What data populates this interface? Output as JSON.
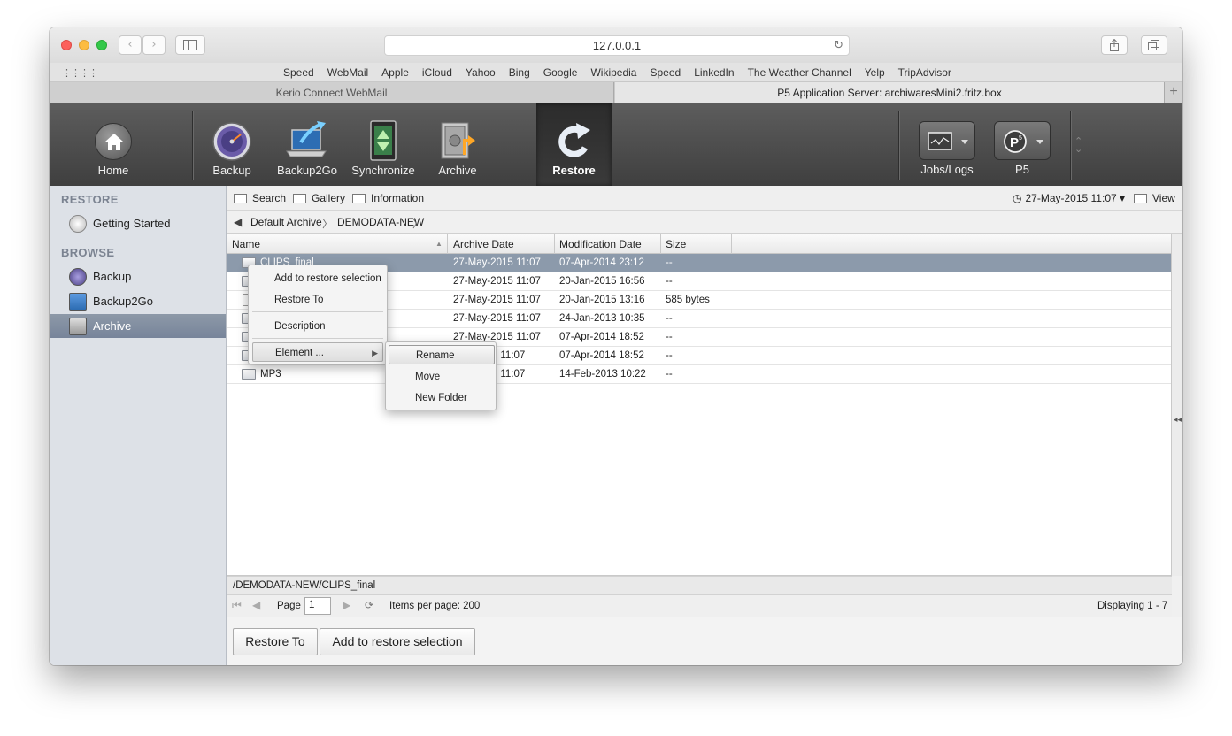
{
  "browser": {
    "url": "127.0.0.1",
    "bookmarks": [
      "Speed",
      "WebMail",
      "Apple",
      "iCloud",
      "Yahoo",
      "Bing",
      "Google",
      "Wikipedia",
      "Speed",
      "LinkedIn",
      "The Weather Channel",
      "Yelp",
      "TripAdvisor"
    ],
    "tabs": [
      {
        "label": "Kerio Connect WebMail",
        "active": false
      },
      {
        "label": "P5 Application Server: archiwaresMini2.fritz.box",
        "active": true
      }
    ],
    "new_tab_symbol": "+"
  },
  "toolbar": {
    "home": "Home",
    "backup": "Backup",
    "backup2go": "Backup2Go",
    "synchronize": "Synchronize",
    "archive": "Archive",
    "restore": "Restore",
    "jobs_logs": "Jobs/Logs",
    "p5": "P5",
    "active": "Restore"
  },
  "sidebar": {
    "restore_heading": "RESTORE",
    "getting_started": "Getting Started",
    "browse_heading": "BROWSE",
    "items": [
      "Backup",
      "Backup2Go",
      "Archive"
    ],
    "selected": "Archive"
  },
  "main": {
    "search": "Search",
    "gallery": "Gallery",
    "information": "Information",
    "date_selector": "27-May-2015 11:07",
    "view": "View",
    "breadcrumb": [
      "Default Archive",
      "DEMODATA-NEW"
    ],
    "columns": {
      "name": "Name",
      "archive_date": "Archive Date",
      "modification_date": "Modification Date",
      "size": "Size"
    },
    "rows": [
      {
        "name": "CLIPS_final",
        "archive_date": "27-May-2015 11:07",
        "modification_date": "07-Apr-2014 23:12",
        "size": "--",
        "kind": "folder",
        "selected": true
      },
      {
        "name": "",
        "archive_date": "27-May-2015 11:07",
        "modification_date": "20-Jan-2015 16:56",
        "size": "--",
        "kind": "folder"
      },
      {
        "name": "",
        "archive_date": "27-May-2015 11:07",
        "modification_date": "20-Jan-2015 13:16",
        "size": "585 bytes",
        "kind": "file"
      },
      {
        "name": "",
        "archive_date": "27-May-2015 11:07",
        "modification_date": "24-Jan-2013 10:35",
        "size": "--",
        "kind": "folder"
      },
      {
        "name": "",
        "archive_date": "27-May-2015 11:07",
        "modification_date": "07-Apr-2014 18:52",
        "size": "--",
        "kind": "folder"
      },
      {
        "name": "",
        "archive_date": "015 11:07",
        "modification_date": "07-Apr-2014 18:52",
        "size": "--",
        "kind": "folder"
      },
      {
        "name": "MP3",
        "archive_date": "015 11:07",
        "modification_date": "14-Feb-2013 10:22",
        "size": "--",
        "kind": "folder"
      }
    ],
    "path": "/DEMODATA-NEW/CLIPS_final",
    "page_label": "Page",
    "page_value": "1",
    "items_per_page": "Items per page: 200",
    "displaying": "Displaying 1 - 7",
    "restore_to_button": "Restore To",
    "add_selection_button": "Add to restore selection"
  },
  "context_menu": {
    "items": [
      "Add to restore selection",
      "Restore To",
      "Description",
      "Element ..."
    ],
    "submenu": [
      "Rename",
      "Move",
      "New Folder"
    ],
    "highlighted_submenu": "Rename"
  }
}
